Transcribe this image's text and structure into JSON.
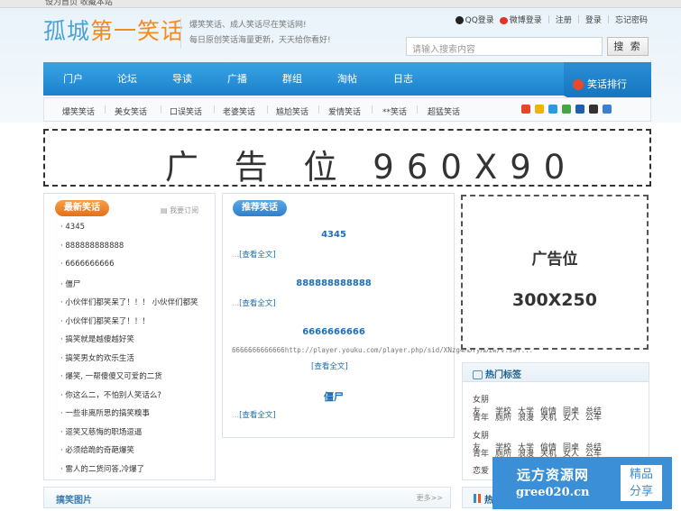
{
  "topbar": {
    "text": "设为首页  收藏本站"
  },
  "header": {
    "logo_main": "孤城",
    "logo_accent": "第一笑话",
    "slogan_line1": "爆笑笑话、成人笑话尽在笑话网!",
    "slogan_line2": "每日原创笑话海量更新，天天给你看好!",
    "qq_login": "QQ登录",
    "weibo_login": "微博登录",
    "register": "注册",
    "login": "登录",
    "forgot": "忘记密码",
    "search_placeholder": "请输入搜索内容",
    "search_button": "搜 索"
  },
  "nav": {
    "items": [
      "门户",
      "论坛",
      "导读",
      "广播",
      "群组",
      "淘帖",
      "日志"
    ],
    "rank_label": "笑话排行"
  },
  "subnav": {
    "items": [
      "爆笑笑话",
      "美女笑话",
      "口误笑话",
      "老婆笑话",
      "尴尬笑话",
      "爱情笑话",
      "**笑话",
      "超猛笑话"
    ]
  },
  "banner": {
    "text": "广 告 位  960X90"
  },
  "latest": {
    "title": "最新笑话",
    "subscribe": "我要订阅",
    "items": [
      "· 4345",
      "· 888888888888",
      "· 6666666666",
      "· 僵尸",
      "· 小伙伴们都笑呆了！！！  小伙伴们都笑",
      "· 小伙伴们都笑呆了！！！",
      "· 搞笑就是越傻越好笑",
      "· 搞笑男女的欢乐生活",
      "· 爆笑, 一帮傻傻又可爱的二货",
      "· 你这么二，不怕别人笑话么?",
      "· 一些非离所思的搞笑糗事",
      "· 逗笑又慈悔的职场逗逼",
      "· 必须给跪的奇葩爆笑",
      "· 雷人的二货问答,冷爆了"
    ]
  },
  "recommend": {
    "title": "推荐笑话",
    "read_more": "[查看全文]",
    "dots": "...",
    "items": [
      {
        "title": "4345",
        "snippet": ""
      },
      {
        "title": "888888888888",
        "snippet": ""
      },
      {
        "title": "6666666666",
        "snippet": "6666666666666http://player.youku.com/player.php/sid/XNzg4MDYyMDIw/v.swf..."
      },
      {
        "title": "僵尸",
        "snippet": ""
      }
    ]
  },
  "ad300": {
    "line1": "广告位",
    "line2": "300X250"
  },
  "hot_tags": {
    "title": "热门标签",
    "rows": [
      [
        "女朋友",
        "学校",
        "大学",
        "偷情",
        "同桌",
        "总结"
      ],
      [
        "青年",
        "厕所",
        "浪漫",
        "关机",
        "女人",
        "公车"
      ],
      [
        "女朋友",
        "学校",
        "大学",
        "偷情",
        "同桌",
        "总结"
      ],
      [
        "青年",
        "厕所",
        "浪漫",
        "关机",
        "女人",
        "公车"
      ],
      [
        "恋爱"
      ]
    ]
  },
  "funny_pics": {
    "title": "搞笑图片",
    "more": "更多>>"
  },
  "right_bottom": {
    "title": "热"
  },
  "watermark": {
    "line1": "远方资源网",
    "line2": "gree020.cn",
    "badge": "精品分享",
    "badge_line1": "精品",
    "badge_line2": "分享"
  },
  "colors": {
    "nav_blue": "#1b82cc",
    "accent_orange": "#f28a1e",
    "logo_blue": "#4aa3d6",
    "link_blue": "#1f6fb5"
  }
}
